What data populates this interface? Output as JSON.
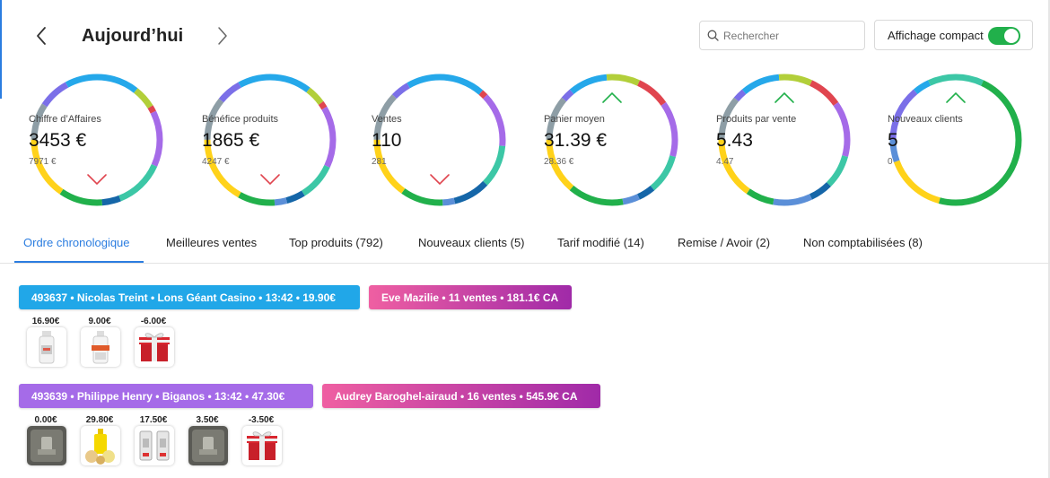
{
  "header": {
    "title": "Aujourd’hui",
    "search_placeholder": "Rechercher",
    "compact_label": "Affichage compact",
    "compact_enabled": true
  },
  "stats": [
    {
      "label": "Chiffre d’Affaires",
      "value": "3453 €",
      "previous": "7971 €",
      "trend": "down"
    },
    {
      "label": "Bénéfice produits",
      "value": "1865 €",
      "previous": "4247 €",
      "trend": "down"
    },
    {
      "label": "Ventes",
      "value": "110",
      "previous": "281",
      "trend": "down"
    },
    {
      "label": "Panier moyen",
      "value": "31.39 €",
      "previous": "28.36 €",
      "trend": "up"
    },
    {
      "label": "Produits par vente",
      "value": "5.43",
      "previous": "4.47",
      "trend": "up"
    },
    {
      "label": "Nouveaux clients",
      "value": "5",
      "previous": "0",
      "trend": "up"
    }
  ],
  "colors": {
    "accent": "#2b7de0",
    "trend_down": "#e0454f",
    "trend_up": "#21b04b",
    "order_blue": "#21a7e8",
    "order_violet": "#a56be8",
    "seller_gradient": [
      "#ef5fa2",
      "#a02aa8"
    ]
  },
  "tabs": [
    {
      "label": "Ordre chronologique",
      "active": true
    },
    {
      "label": "Meilleures ventes"
    },
    {
      "label": "Top produits (792)"
    },
    {
      "label": "Nouveaux clients (5)"
    },
    {
      "label": "Tarif modifié (14)"
    },
    {
      "label": "Remise / Avoir (2)"
    },
    {
      "label": "Non comptabilisées (8)"
    }
  ],
  "orders": [
    {
      "summary": "493637 • Nicolas Treint • Lons Géant Casino • 13:42 • 19.90€",
      "seller": "Eve Mazilie • 11 ventes • 181.1€ CA",
      "items": [
        {
          "price": "16.90€",
          "icon": "eliquid-bottle-icon"
        },
        {
          "price": "9.00€",
          "icon": "booster-bottle-icon"
        },
        {
          "price": "-6.00€",
          "icon": "gift-icon"
        }
      ]
    },
    {
      "summary": "493639 • Philippe Henry • Biganos • 13:42 • 47.30€",
      "seller": "Audrey Baroghel-airaud • 16 ventes • 545.9€ CA",
      "items": [
        {
          "price": "0.00€",
          "icon": "coil-icon"
        },
        {
          "price": "29.80€",
          "icon": "fruit-eliquid-icon"
        },
        {
          "price": "17.50€",
          "icon": "pod-cartridges-icon"
        },
        {
          "price": "3.50€",
          "icon": "coil-icon"
        },
        {
          "price": "-3.50€",
          "icon": "gift-icon"
        }
      ]
    }
  ]
}
